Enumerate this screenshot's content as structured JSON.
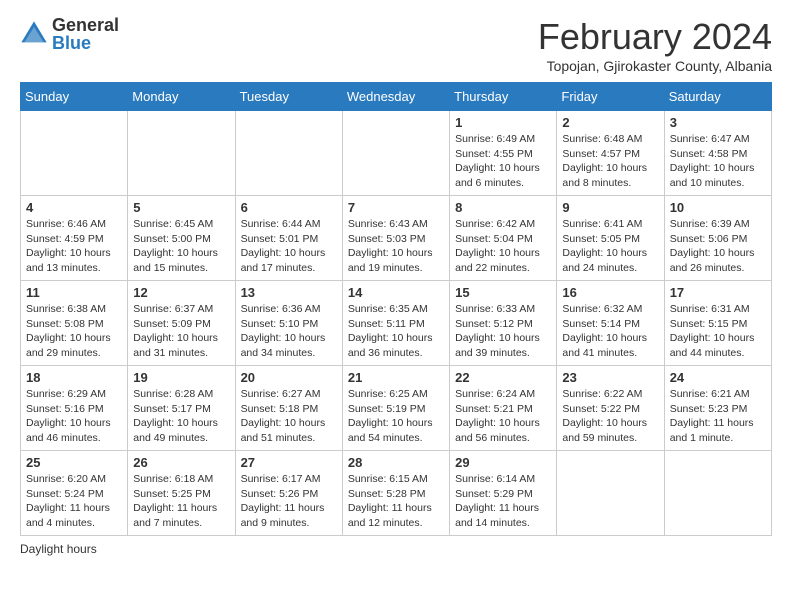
{
  "logo": {
    "general": "General",
    "blue": "Blue"
  },
  "title": "February 2024",
  "subtitle": "Topojan, Gjirokaster County, Albania",
  "days_of_week": [
    "Sunday",
    "Monday",
    "Tuesday",
    "Wednesday",
    "Thursday",
    "Friday",
    "Saturday"
  ],
  "footer": "Daylight hours",
  "weeks": [
    [
      {
        "day": "",
        "info": ""
      },
      {
        "day": "",
        "info": ""
      },
      {
        "day": "",
        "info": ""
      },
      {
        "day": "",
        "info": ""
      },
      {
        "day": "1",
        "info": "Sunrise: 6:49 AM\nSunset: 4:55 PM\nDaylight: 10 hours\nand 6 minutes."
      },
      {
        "day": "2",
        "info": "Sunrise: 6:48 AM\nSunset: 4:57 PM\nDaylight: 10 hours\nand 8 minutes."
      },
      {
        "day": "3",
        "info": "Sunrise: 6:47 AM\nSunset: 4:58 PM\nDaylight: 10 hours\nand 10 minutes."
      }
    ],
    [
      {
        "day": "4",
        "info": "Sunrise: 6:46 AM\nSunset: 4:59 PM\nDaylight: 10 hours\nand 13 minutes."
      },
      {
        "day": "5",
        "info": "Sunrise: 6:45 AM\nSunset: 5:00 PM\nDaylight: 10 hours\nand 15 minutes."
      },
      {
        "day": "6",
        "info": "Sunrise: 6:44 AM\nSunset: 5:01 PM\nDaylight: 10 hours\nand 17 minutes."
      },
      {
        "day": "7",
        "info": "Sunrise: 6:43 AM\nSunset: 5:03 PM\nDaylight: 10 hours\nand 19 minutes."
      },
      {
        "day": "8",
        "info": "Sunrise: 6:42 AM\nSunset: 5:04 PM\nDaylight: 10 hours\nand 22 minutes."
      },
      {
        "day": "9",
        "info": "Sunrise: 6:41 AM\nSunset: 5:05 PM\nDaylight: 10 hours\nand 24 minutes."
      },
      {
        "day": "10",
        "info": "Sunrise: 6:39 AM\nSunset: 5:06 PM\nDaylight: 10 hours\nand 26 minutes."
      }
    ],
    [
      {
        "day": "11",
        "info": "Sunrise: 6:38 AM\nSunset: 5:08 PM\nDaylight: 10 hours\nand 29 minutes."
      },
      {
        "day": "12",
        "info": "Sunrise: 6:37 AM\nSunset: 5:09 PM\nDaylight: 10 hours\nand 31 minutes."
      },
      {
        "day": "13",
        "info": "Sunrise: 6:36 AM\nSunset: 5:10 PM\nDaylight: 10 hours\nand 34 minutes."
      },
      {
        "day": "14",
        "info": "Sunrise: 6:35 AM\nSunset: 5:11 PM\nDaylight: 10 hours\nand 36 minutes."
      },
      {
        "day": "15",
        "info": "Sunrise: 6:33 AM\nSunset: 5:12 PM\nDaylight: 10 hours\nand 39 minutes."
      },
      {
        "day": "16",
        "info": "Sunrise: 6:32 AM\nSunset: 5:14 PM\nDaylight: 10 hours\nand 41 minutes."
      },
      {
        "day": "17",
        "info": "Sunrise: 6:31 AM\nSunset: 5:15 PM\nDaylight: 10 hours\nand 44 minutes."
      }
    ],
    [
      {
        "day": "18",
        "info": "Sunrise: 6:29 AM\nSunset: 5:16 PM\nDaylight: 10 hours\nand 46 minutes."
      },
      {
        "day": "19",
        "info": "Sunrise: 6:28 AM\nSunset: 5:17 PM\nDaylight: 10 hours\nand 49 minutes."
      },
      {
        "day": "20",
        "info": "Sunrise: 6:27 AM\nSunset: 5:18 PM\nDaylight: 10 hours\nand 51 minutes."
      },
      {
        "day": "21",
        "info": "Sunrise: 6:25 AM\nSunset: 5:19 PM\nDaylight: 10 hours\nand 54 minutes."
      },
      {
        "day": "22",
        "info": "Sunrise: 6:24 AM\nSunset: 5:21 PM\nDaylight: 10 hours\nand 56 minutes."
      },
      {
        "day": "23",
        "info": "Sunrise: 6:22 AM\nSunset: 5:22 PM\nDaylight: 10 hours\nand 59 minutes."
      },
      {
        "day": "24",
        "info": "Sunrise: 6:21 AM\nSunset: 5:23 PM\nDaylight: 11 hours\nand 1 minute."
      }
    ],
    [
      {
        "day": "25",
        "info": "Sunrise: 6:20 AM\nSunset: 5:24 PM\nDaylight: 11 hours\nand 4 minutes."
      },
      {
        "day": "26",
        "info": "Sunrise: 6:18 AM\nSunset: 5:25 PM\nDaylight: 11 hours\nand 7 minutes."
      },
      {
        "day": "27",
        "info": "Sunrise: 6:17 AM\nSunset: 5:26 PM\nDaylight: 11 hours\nand 9 minutes."
      },
      {
        "day": "28",
        "info": "Sunrise: 6:15 AM\nSunset: 5:28 PM\nDaylight: 11 hours\nand 12 minutes."
      },
      {
        "day": "29",
        "info": "Sunrise: 6:14 AM\nSunset: 5:29 PM\nDaylight: 11 hours\nand 14 minutes."
      },
      {
        "day": "",
        "info": ""
      },
      {
        "day": "",
        "info": ""
      }
    ]
  ]
}
